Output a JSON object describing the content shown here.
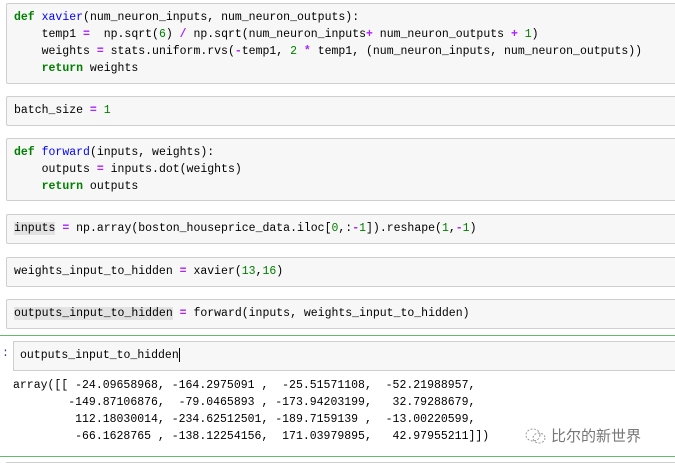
{
  "cells": [
    {
      "lines": [
        [
          [
            "kw",
            "def"
          ],
          [
            "",
            " "
          ],
          [
            "fn",
            "xavier"
          ],
          [
            "",
            "(num_neuron_inputs, num_neuron_outputs):"
          ]
        ],
        [
          [
            "",
            "    temp1 "
          ],
          [
            "op",
            "="
          ],
          [
            "",
            "  np.sqrt("
          ],
          [
            "num",
            "6"
          ],
          [
            "",
            ") "
          ],
          [
            "op",
            "/"
          ],
          [
            "",
            " np.sqrt(num_neuron_inputs"
          ],
          [
            "op",
            "+"
          ],
          [
            "",
            " num_neuron_outputs "
          ],
          [
            "op",
            "+"
          ],
          [
            "num",
            " 1"
          ],
          [
            "",
            ")"
          ]
        ],
        [
          [
            "",
            "    weights "
          ],
          [
            "op",
            "="
          ],
          [
            "",
            " stats.uniform.rvs("
          ],
          [
            "op",
            "-"
          ],
          [
            "",
            "temp1, "
          ],
          [
            "num",
            "2"
          ],
          [
            "op",
            " *"
          ],
          [
            "",
            " temp1, (num_neuron_inputs, num_neuron_outputs))"
          ]
        ],
        [
          [
            "",
            "    "
          ],
          [
            "kw",
            "return"
          ],
          [
            "",
            " weights"
          ]
        ]
      ]
    },
    {
      "lines": [
        [
          [
            "",
            "batch_size "
          ],
          [
            "op",
            "="
          ],
          [
            "num",
            " 1"
          ]
        ]
      ]
    },
    {
      "lines": [
        [
          [
            "kw",
            "def"
          ],
          [
            "",
            " "
          ],
          [
            "fn",
            "forward"
          ],
          [
            "",
            "(inputs, weights):"
          ]
        ],
        [
          [
            "",
            "    outputs "
          ],
          [
            "op",
            "="
          ],
          [
            "",
            " inputs.dot(weights)"
          ]
        ],
        [
          [
            "",
            "    "
          ],
          [
            "kw",
            "return"
          ],
          [
            "",
            " outputs"
          ]
        ]
      ]
    },
    {
      "lines": [
        [
          [
            "hl",
            "inputs"
          ],
          [
            "",
            " "
          ],
          [
            "op",
            "="
          ],
          [
            "",
            " np.array(boston_houseprice_data.iloc["
          ],
          [
            "num",
            "0"
          ],
          [
            "",
            ",:"
          ],
          [
            "op",
            "-"
          ],
          [
            "num",
            "1"
          ],
          [
            "",
            "]).reshape("
          ],
          [
            "num",
            "1"
          ],
          [
            "",
            ","
          ],
          [
            "op",
            "-"
          ],
          [
            "num",
            "1"
          ],
          [
            "",
            ")"
          ]
        ]
      ]
    },
    {
      "lines": [
        [
          [
            "",
            "weights_input_to_hidden "
          ],
          [
            "op",
            "="
          ],
          [
            "",
            " xavier("
          ],
          [
            "num",
            "13"
          ],
          [
            "",
            ","
          ],
          [
            "num",
            "16"
          ],
          [
            "",
            ")"
          ]
        ]
      ]
    },
    {
      "lines": [
        [
          [
            "hl",
            "outputs_input_to_hidden"
          ],
          [
            "",
            " "
          ],
          [
            "op",
            "="
          ],
          [
            "",
            " forward(inputs, weights_input_to_hidden)"
          ]
        ]
      ]
    }
  ],
  "active_cell": {
    "prompt": ":",
    "input": "outputs_input_to_hidden",
    "output": [
      "array([[ -24.09658968, -164.2975091 ,  -25.51571108,  -52.21988957,",
      "        -149.87106876,  -79.0465893 , -173.94203199,   32.79288679,",
      "         112.18030014, -234.62512501, -189.7159139 ,  -13.00220599,",
      "         -66.1628765 , -138.12254156,  171.03979895,   42.97955211]])"
    ]
  },
  "watermark": "比尔的新世界"
}
